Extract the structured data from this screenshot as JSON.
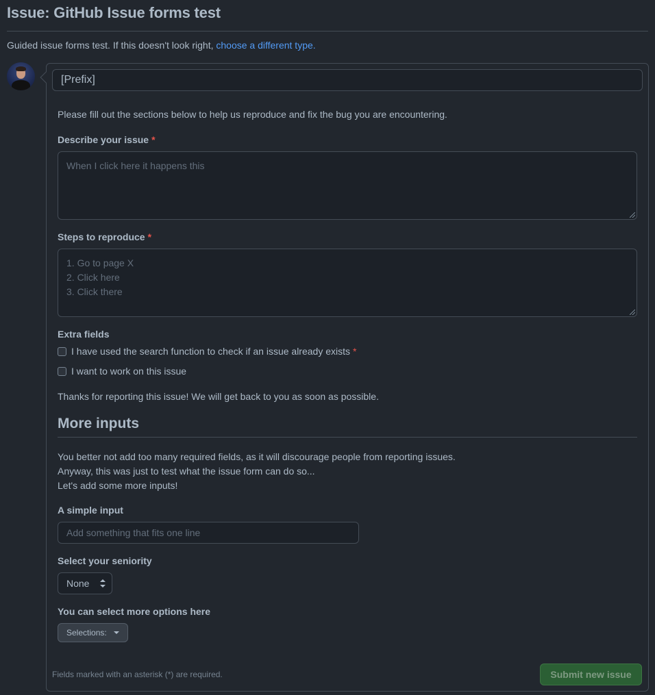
{
  "page": {
    "title": "Issue: GitHub Issue forms test",
    "subtitle_text": "Guided issue forms test. If this doesn't look right, ",
    "subtitle_link": "choose a different type."
  },
  "form": {
    "title_value": "[Prefix]",
    "intro": "Please fill out the sections below to help us reproduce and fix the bug you are encountering.",
    "describe": {
      "label": "Describe your issue",
      "required_mark": "*",
      "placeholder": "When I click here it happens this"
    },
    "steps": {
      "label": "Steps to reproduce",
      "required_mark": "*",
      "placeholder": "1. Go to page X\n2. Click here\n3. Click there"
    },
    "extra_fields": {
      "label": "Extra fields",
      "options": [
        {
          "label": "I have used the search function to check if an issue already exists",
          "required_mark": "*",
          "checked": false
        },
        {
          "label": "I want to work on this issue",
          "checked": false
        }
      ]
    },
    "thanks": "Thanks for reporting this issue! We will get back to you as soon as possible.",
    "more_inputs": {
      "heading": "More inputs",
      "lines": [
        "You better not add too many required fields, as it will discourage people from reporting issues.",
        "Anyway, this was just to test what the issue form can do so...",
        "Let's add some more inputs!"
      ]
    },
    "simple_input": {
      "label": "A simple input",
      "placeholder": "Add something that fits one line"
    },
    "seniority": {
      "label": "Select your seniority",
      "value": "None"
    },
    "multi_select": {
      "label": "You can select more options here",
      "button": "Selections:"
    },
    "footer_note": "Fields marked with an asterisk (*) are required.",
    "submit_label": "Submit new issue"
  },
  "colors": {
    "background": "#22272e",
    "text": "#adbac7",
    "link": "#539bf5",
    "required": "#e5534b",
    "submit_bg": "#2b5f34"
  }
}
